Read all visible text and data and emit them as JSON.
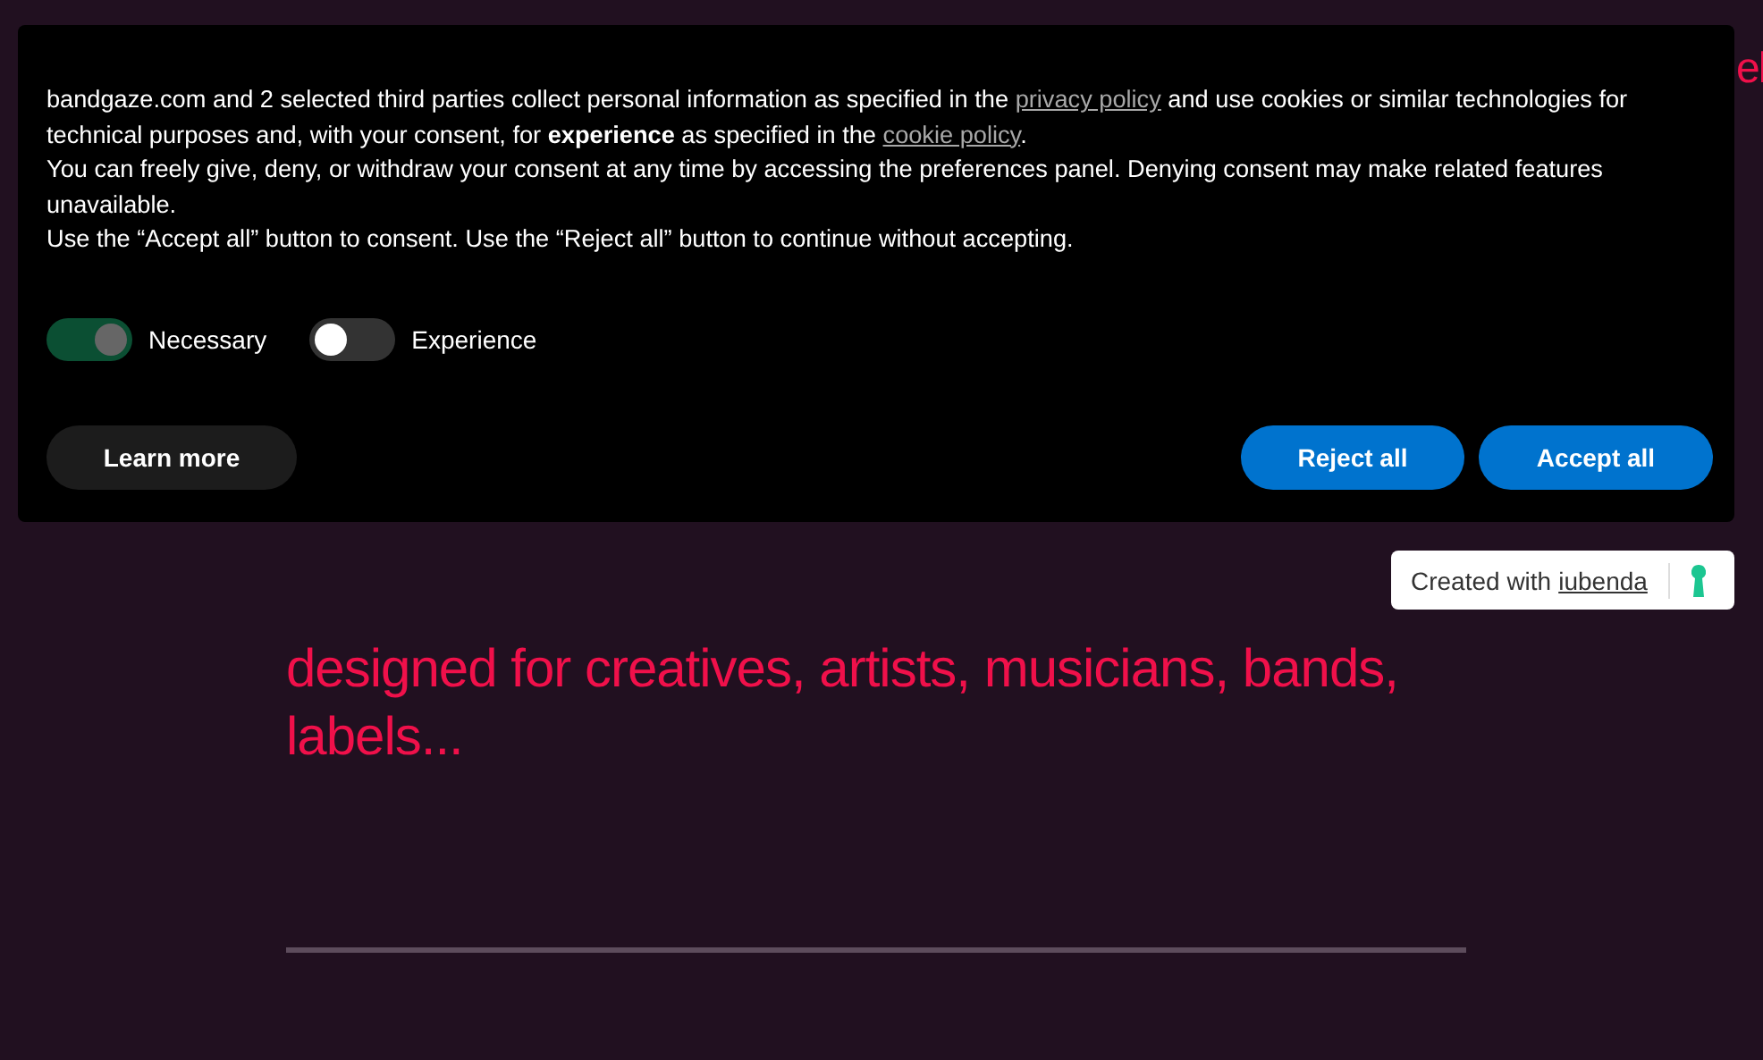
{
  "page": {
    "corner_text": "el",
    "tagline": "designed for creatives, artists, musicians, bands, labels..."
  },
  "consent_banner": {
    "paragraphs": [
      [
        {
          "text": "bandgaze.com and 2 selected third parties collect personal information as specified in the "
        },
        {
          "link": "privacy policy"
        },
        {
          "text": " and use cookies or similar technologies for technical purposes and, with your consent, for **experience** as specified in the "
        },
        {
          "link": "cookie policy"
        },
        {
          "text": "."
        }
      ],
      "You can freely give, deny, or withdraw your consent at any time by accessing the preferences panel. Denying consent may make related features unavailable.",
      "Use the “Accept all” button to consent. Use the “Reject all” button to continue without accepting."
    ],
    "toggles": [
      {
        "label": "Necessary",
        "on": true,
        "disabled": true
      },
      {
        "label": "Experience",
        "on": false,
        "disabled": false
      }
    ],
    "buttons": [
      {
        "label": "Learn more",
        "kind": "secondary"
      },
      {
        "label": "Reject all",
        "kind": "primary"
      },
      {
        "label": "Accept all",
        "kind": "primary"
      }
    ]
  },
  "badge": {
    "text": "Created with",
    "link": "iubenda"
  }
}
